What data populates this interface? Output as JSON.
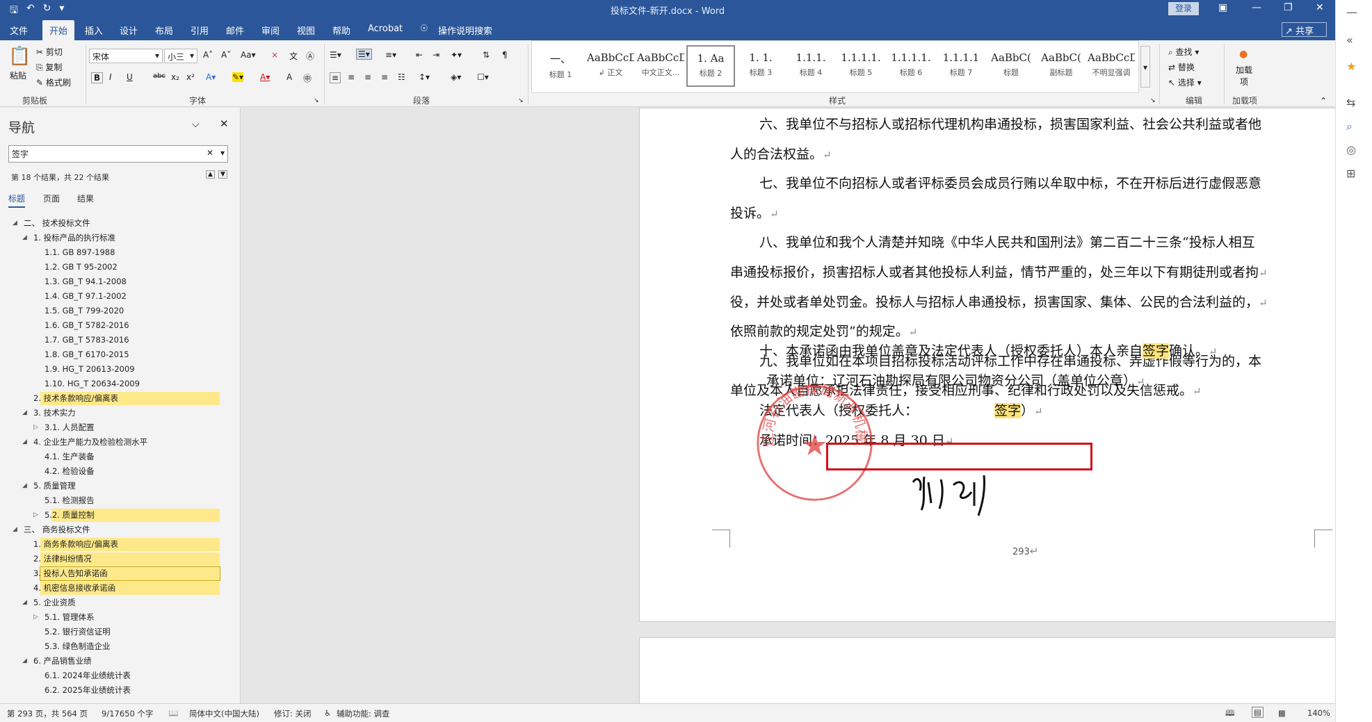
{
  "title_bar": {
    "doc_title": "投标文件-新开.docx  -  Word",
    "login_label": "登录"
  },
  "tabs": [
    "文件",
    "开始",
    "插入",
    "设计",
    "布局",
    "引用",
    "邮件",
    "审阅",
    "视图",
    "帮助",
    "Acrobat",
    "操作说明搜索"
  ],
  "share_label": "共享",
  "ribbon": {
    "clipboard": {
      "paste": "粘贴",
      "cut": "剪切",
      "copy": "复制",
      "format_painter": "格式刷",
      "group": "剪贴板"
    },
    "font": {
      "name": "宋体",
      "size": "小三",
      "group": "字体"
    },
    "paragraph": {
      "group": "段落"
    },
    "styles": {
      "group": "样式",
      "items": [
        {
          "sample": "一、",
          "name": "标题 1"
        },
        {
          "sample": "AaBbCcDdI",
          "name": "↲ 正文"
        },
        {
          "sample": "AaBbCcDc",
          "name": "中文正文..."
        },
        {
          "sample": "1.   Aa",
          "name": "标题 2"
        },
        {
          "sample": "1. 1.",
          "name": "标题 3"
        },
        {
          "sample": "1.1.1.",
          "name": "标题 4"
        },
        {
          "sample": "1.1.1.1.",
          "name": "标题 5"
        },
        {
          "sample": "1.1.1.1.",
          "name": "标题 6"
        },
        {
          "sample": "1.1.1.1",
          "name": "标题 7"
        },
        {
          "sample": "AaBbC(",
          "name": "标题"
        },
        {
          "sample": "AaBbC(",
          "name": "副标题"
        },
        {
          "sample": "AaBbCcD.",
          "name": "不明显强调"
        }
      ]
    },
    "editing": {
      "find": "查找",
      "replace": "替换",
      "select": "选择",
      "group": "编辑"
    },
    "addins": {
      "label": "加载项",
      "group": "加载项"
    }
  },
  "nav": {
    "title": "导航",
    "search_value": "签字",
    "result_count": "第 18 个结果，共 22 个结果",
    "tabs": [
      "标题",
      "页面",
      "结果"
    ],
    "tree": [
      {
        "label": "二、 技术投标文件",
        "level": 0,
        "expanded": true,
        "hl": false
      },
      {
        "label": "1. 投标产品的执行标准",
        "level": 1,
        "expanded": true,
        "hl": false
      },
      {
        "label": "1.1. GB 897-1988",
        "level": 2,
        "hl": false
      },
      {
        "label": "1.2. GB T 95-2002",
        "level": 2,
        "hl": false
      },
      {
        "label": "1.3. GB_T 94.1-2008",
        "level": 2,
        "hl": false
      },
      {
        "label": "1.4. GB_T 97.1-2002",
        "level": 2,
        "hl": false
      },
      {
        "label": "1.5. GB_T 799-2020",
        "level": 2,
        "hl": false
      },
      {
        "label": "1.6. GB_T 5782-2016",
        "level": 2,
        "hl": false
      },
      {
        "label": "1.7. GB_T 5783-2016",
        "level": 2,
        "hl": false
      },
      {
        "label": "1.8. GB_T 6170-2015",
        "level": 2,
        "hl": false
      },
      {
        "label": "1.9. HG_T 20613-2009",
        "level": 2,
        "hl": false
      },
      {
        "label": "1.10. HG_T 20634-2009",
        "level": 2,
        "hl": false
      },
      {
        "label": "2. 技术条款响应/偏离表",
        "level": 1,
        "hl": true
      },
      {
        "label": "3. 技术实力",
        "level": 1,
        "expanded": true,
        "hl": false
      },
      {
        "label": "3.1. 人员配置",
        "level": 2,
        "collapsed": true,
        "hl": false
      },
      {
        "label": "4. 企业生产能力及检验检测水平",
        "level": 1,
        "expanded": true,
        "hl": false
      },
      {
        "label": "4.1. 生产装备",
        "level": 2,
        "hl": false
      },
      {
        "label": "4.2. 检验设备",
        "level": 2,
        "hl": false
      },
      {
        "label": "5. 质量管理",
        "level": 1,
        "expanded": true,
        "hl": false
      },
      {
        "label": "5.1. 检测报告",
        "level": 2,
        "hl": false
      },
      {
        "label": "5.2. 质量控制",
        "level": 2,
        "collapsed": true,
        "hl": true
      },
      {
        "label": "三、 商务投标文件",
        "level": 0,
        "expanded": true,
        "hl": false
      },
      {
        "label": "1. 商务条款响应/偏离表",
        "level": 1,
        "hl": true
      },
      {
        "label": "2. 法律纠纷情况",
        "level": 1,
        "hl": true
      },
      {
        "label": "3. 投标人告知承诺函",
        "level": 1,
        "hl": true,
        "selected": true
      },
      {
        "label": "4. 机密信息接收承诺函",
        "level": 1,
        "hl": true
      },
      {
        "label": "5. 企业资质",
        "level": 1,
        "expanded": true,
        "hl": false
      },
      {
        "label": "5.1. 管理体系",
        "level": 2,
        "collapsed": true,
        "hl": false
      },
      {
        "label": "5.2. 银行资信证明",
        "level": 2,
        "hl": false
      },
      {
        "label": "5.3. 绿色制造企业",
        "level": 2,
        "hl": false
      },
      {
        "label": "6. 产品销售业绩",
        "level": 1,
        "expanded": true,
        "hl": false
      },
      {
        "label": "6.1. 2024年业绩统计表",
        "level": 2,
        "hl": false
      },
      {
        "label": "6.2. 2025年业绩统计表",
        "level": 2,
        "hl": false
      }
    ]
  },
  "document": {
    "lines": [
      {
        "text": "六、我单位不与招标人或招标代理机构串通投标，损害国家利益、社会公共利益或者他",
        "indent": true
      },
      {
        "text": "人的合法权益。",
        "indent": false
      },
      {
        "text": "七、我单位不向招标人或者评标委员会成员行贿以牟取中标，不在开标后进行虚假恶意",
        "indent": true
      },
      {
        "text": "投诉。",
        "indent": false
      },
      {
        "text": "八、我单位和我个人清楚并知晓《中华人民共和国刑法》第二百二十三条“投标人相互",
        "indent": true
      },
      {
        "text": "串通投标报价，损害招标人或者其他投标人利益，情节严重的，处三年以下有期徒刑或者拘",
        "indent": false
      },
      {
        "text": "役，并处或者单处罚金。投标人与招标人串通投标，损害国家、集体、公民的合法利益的，",
        "indent": false
      },
      {
        "text": "依照前款的规定处罚”的规定。",
        "indent": false
      },
      {
        "text": "九、我单位如在本项目招标投标活动评标工作中存在串通投标、弄虚作假等行为的，本",
        "indent": true
      },
      {
        "text": "单位及本人自愿承担法律责任，接受相应刑事、纪律和行政处罚以及失信惩戒。",
        "indent": false
      }
    ],
    "line10_a": "十、本承诺函由我单位盖章及法定代表人（授权委托人）本人亲自",
    "line10_hl": "签字",
    "line10_b": "确认。",
    "unit_label": "承诺单位：",
    "unit_value": "辽河石油勘探局有限公司物资分公司（盖单位公章）",
    "rep_a": "法定代表人（授权委托人：",
    "rep_hl": "签字",
    "rep_b": "）",
    "date_line": "承诺时间：2025 年 8 月 30 日",
    "page_number": "293",
    "paragraph_mark": "↵",
    "seal_text": "辽河石油勘探局新开机械厂"
  },
  "status": {
    "page": "第 293 页，共 564 页",
    "words": "9/17650 个字",
    "lang": "简体中文(中国大陆)",
    "track": "修订: 关闭",
    "access": "辅助功能: 调查",
    "zoom": "140%"
  }
}
